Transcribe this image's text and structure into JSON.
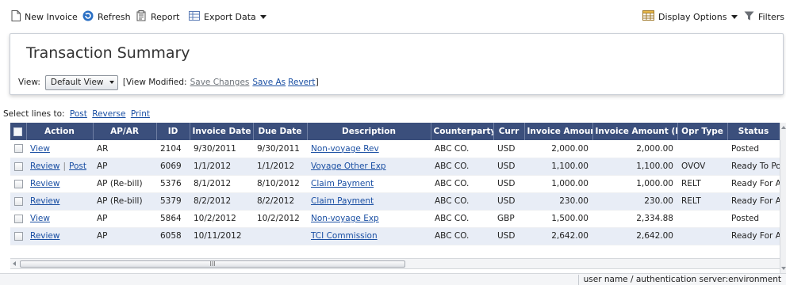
{
  "toolbar": {
    "new_invoice": "New Invoice",
    "refresh": "Refresh",
    "report": "Report",
    "export_data": "Export Data",
    "display_options": "Display Options",
    "filters": "Filters"
  },
  "summary": {
    "title": "Transaction Summary",
    "view_label": "View:",
    "view_selected": "Default View",
    "view_modified": "[View Modified:",
    "save_changes": "Save Changes",
    "save_as": "Save As",
    "revert": "Revert",
    "close_bracket": "]"
  },
  "select_lines": {
    "label": "Select lines to:",
    "post": "Post",
    "reverse": "Reverse",
    "print": "Print"
  },
  "table": {
    "columns": [
      "Action",
      "AP/AR",
      "ID",
      "Invoice Date",
      "Due Date",
      "Description",
      "Counterparty",
      "Curr",
      "Invoice Amount",
      "Invoice Amount (Base)",
      "Opr Type",
      "Status"
    ],
    "sort_column": "Counterparty",
    "sort_direction": "ascending",
    "rows": [
      {
        "action1": "View",
        "action2": "",
        "apar": "AR",
        "id": "2104",
        "invoice_date": "9/30/2011",
        "due_date": "9/30/2011",
        "description": "Non-voyage Rev",
        "counterparty": "ABC CO.",
        "curr": "USD",
        "amount": "2,000.00",
        "amount_base": "2,000.00",
        "opr_type": "",
        "status": "Posted"
      },
      {
        "action1": "Review",
        "action2": "Post",
        "apar": "AP",
        "id": "6069",
        "invoice_date": "1/1/2012",
        "due_date": "1/1/2012",
        "description": "Voyage Other Exp",
        "counterparty": "ABC CO.",
        "curr": "USD",
        "amount": "1,100.00",
        "amount_base": "1,100.00",
        "opr_type": "OVOV",
        "status": "Ready To Pos"
      },
      {
        "action1": "Review",
        "action2": "",
        "apar": "AP (Re-bill)",
        "id": "5376",
        "invoice_date": "8/1/2012",
        "due_date": "8/10/2012",
        "description": "Claim Payment",
        "counterparty": "ABC CO.",
        "curr": "USD",
        "amount": "1,000.00",
        "amount_base": "1,000.00",
        "opr_type": "RELT",
        "status": "Ready For Ap"
      },
      {
        "action1": "Review",
        "action2": "",
        "apar": "AP (Re-bill)",
        "id": "5379",
        "invoice_date": "8/2/2012",
        "due_date": "8/2/2012",
        "description": "Claim Payment",
        "counterparty": "ABC CO.",
        "curr": "USD",
        "amount": "230.00",
        "amount_base": "230.00",
        "opr_type": "RELT",
        "status": "Ready For Ap"
      },
      {
        "action1": "View",
        "action2": "",
        "apar": "AP",
        "id": "5864",
        "invoice_date": "10/2/2012",
        "due_date": "10/2/2012",
        "description": "Non-voyage Exp",
        "counterparty": "ABC CO.",
        "curr": "GBP",
        "amount": "1,500.00",
        "amount_base": "2,334.88",
        "opr_type": "",
        "status": "Posted"
      },
      {
        "action1": "Review",
        "action2": "",
        "apar": "AP",
        "id": "6058",
        "invoice_date": "10/11/2012",
        "due_date": "",
        "description": "TCI Commission",
        "counterparty": "ABC CO.",
        "curr": "USD",
        "amount": "2,642.00",
        "amount_base": "2,642.00",
        "opr_type": "",
        "status": "Ready For Ap"
      }
    ]
  },
  "scrollbar": {
    "thumb_grip": "III"
  },
  "statusbar": {
    "user": "user name / authentication server:environment"
  },
  "colors": {
    "header_bg": "#3b4f7c",
    "alt_row_bg": "#e8edf6",
    "link": "#1a4fa3"
  }
}
